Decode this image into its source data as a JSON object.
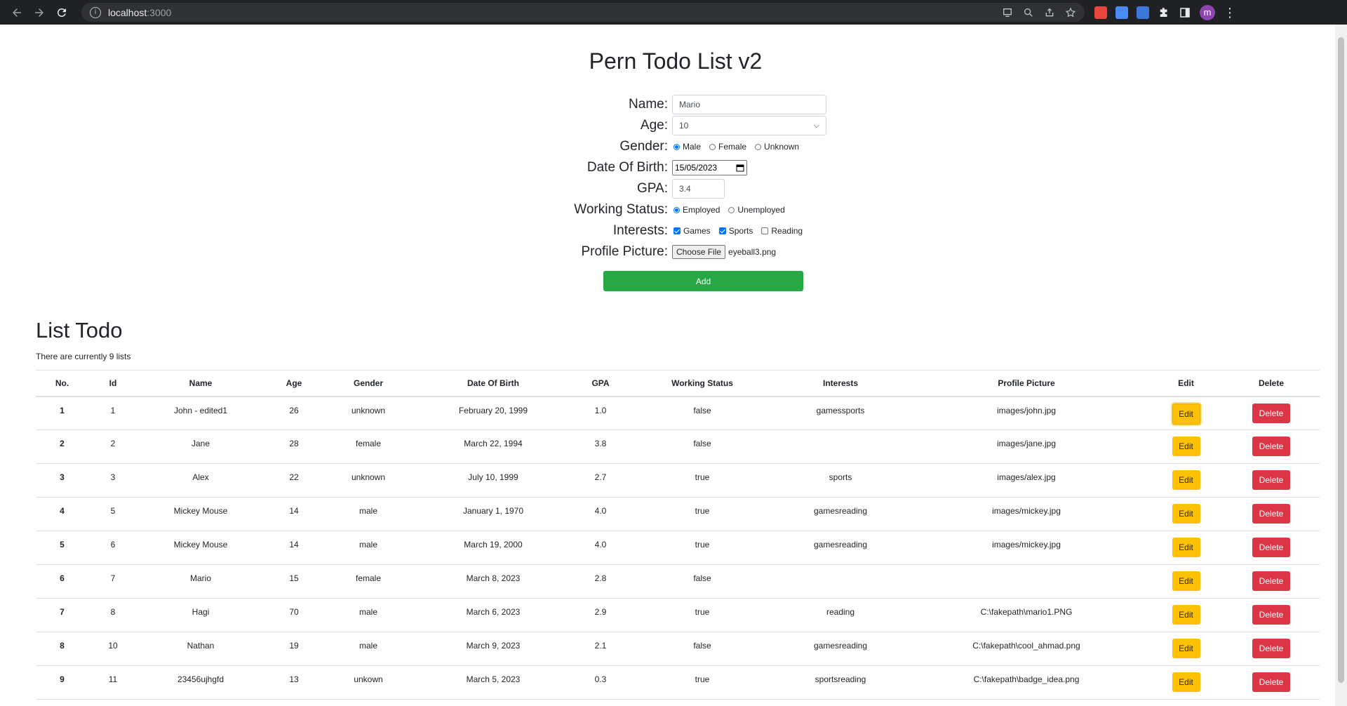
{
  "browser": {
    "url_host": "localhost",
    "url_port": ":3000",
    "avatar_letter": "m"
  },
  "form": {
    "title": "Pern Todo List v2",
    "name_label": "Name:",
    "name_value": "Mario",
    "age_label": "Age:",
    "age_value": "10",
    "gender_label": "Gender:",
    "gender_options": [
      "Male",
      "Female",
      "Unknown"
    ],
    "gender_selected": "Male",
    "dob_label": "Date Of Birth:",
    "dob_value": "15/05/2023",
    "gpa_label": "GPA:",
    "gpa_value": "3.4",
    "working_label": "Working Status:",
    "working_options": [
      "Employed",
      "Unemployed"
    ],
    "working_selected": "Employed",
    "interests_label": "Interests:",
    "interest_options": [
      "Games",
      "Sports",
      "Reading"
    ],
    "interests_checked": [
      "Games",
      "Sports"
    ],
    "picture_label": "Profile Picture:",
    "choose_file_label": "Choose File",
    "file_name": "eyeball3.png",
    "add_label": "Add"
  },
  "list": {
    "title": "List Todo",
    "count_text": "There are currently 9 lists",
    "headers": [
      "No.",
      "Id",
      "Name",
      "Age",
      "Gender",
      "Date Of Birth",
      "GPA",
      "Working Status",
      "Interests",
      "Profile Picture",
      "Edit",
      "Delete"
    ],
    "edit_label": "Edit",
    "delete_label": "Delete",
    "rows": [
      {
        "no": "1",
        "id": "1",
        "name": "John - edited1",
        "age": "26",
        "gender": "unknown",
        "dob": "February 20, 1999",
        "gpa": "1.0",
        "working": "false",
        "interests": "gamessports",
        "picture": "images/john.jpg"
      },
      {
        "no": "2",
        "id": "2",
        "name": "Jane",
        "age": "28",
        "gender": "female",
        "dob": "March 22, 1994",
        "gpa": "3.8",
        "working": "false",
        "interests": "",
        "picture": "images/jane.jpg"
      },
      {
        "no": "3",
        "id": "3",
        "name": "Alex",
        "age": "22",
        "gender": "unknown",
        "dob": "July 10, 1999",
        "gpa": "2.7",
        "working": "true",
        "interests": "sports",
        "picture": "images/alex.jpg"
      },
      {
        "no": "4",
        "id": "5",
        "name": "Mickey Mouse",
        "age": "14",
        "gender": "male",
        "dob": "January 1, 1970",
        "gpa": "4.0",
        "working": "true",
        "interests": "gamesreading",
        "picture": "images/mickey.jpg"
      },
      {
        "no": "5",
        "id": "6",
        "name": "Mickey Mouse",
        "age": "14",
        "gender": "male",
        "dob": "March 19, 2000",
        "gpa": "4.0",
        "working": "true",
        "interests": "gamesreading",
        "picture": "images/mickey.jpg"
      },
      {
        "no": "6",
        "id": "7",
        "name": "Mario",
        "age": "15",
        "gender": "female",
        "dob": "March 8, 2023",
        "gpa": "2.8",
        "working": "false",
        "interests": "",
        "picture": ""
      },
      {
        "no": "7",
        "id": "8",
        "name": "Hagi",
        "age": "70",
        "gender": "male",
        "dob": "March 6, 2023",
        "gpa": "2.9",
        "working": "true",
        "interests": "reading",
        "picture": "C:\\fakepath\\mario1.PNG"
      },
      {
        "no": "8",
        "id": "10",
        "name": "Nathan",
        "age": "19",
        "gender": "male",
        "dob": "March 9, 2023",
        "gpa": "2.1",
        "working": "false",
        "interests": "gamesreading",
        "picture": "C:\\fakepath\\cool_ahmad.png"
      },
      {
        "no": "9",
        "id": "11",
        "name": "23456ujhgfd",
        "age": "13",
        "gender": "unkown",
        "dob": "March 5, 2023",
        "gpa": "0.3",
        "working": "true",
        "interests": "sportsreading",
        "picture": "C:\\fakepath\\badge_idea.png"
      }
    ]
  }
}
